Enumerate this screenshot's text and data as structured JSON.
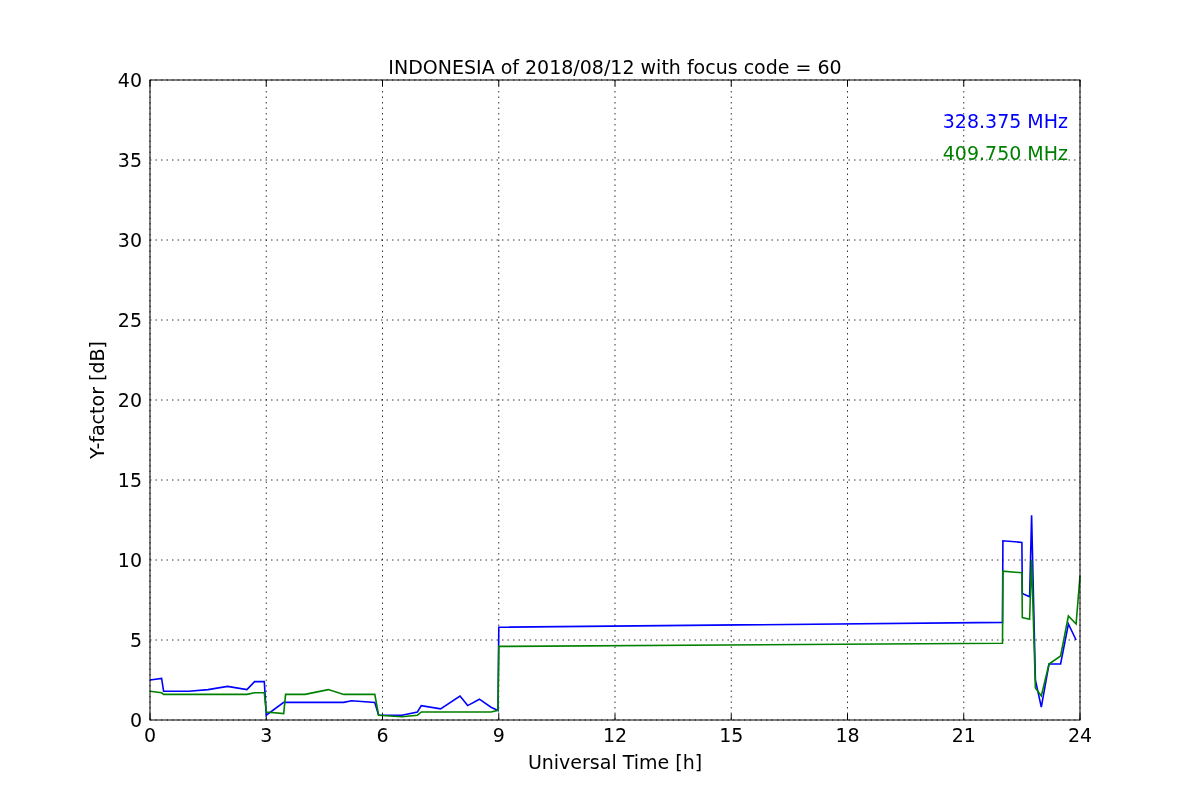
{
  "chart_data": {
    "type": "line",
    "title": "INDONESIA of 2018/08/12 with focus code = 60",
    "xlabel": "Universal Time [h]",
    "ylabel": "Y-factor [dB]",
    "x": [
      0,
      0.3,
      0.35,
      1,
      1.5,
      2,
      2.5,
      2.7,
      2.95,
      3.0,
      3.45,
      3.5,
      4,
      4.6,
      5,
      5.2,
      5.8,
      5.9,
      6.5,
      6.9,
      7,
      7.5,
      8,
      8.2,
      8.5,
      8.8,
      8.98,
      9,
      22,
      22.01,
      22.5,
      22.51,
      22.7,
      22.75,
      22.85,
      23,
      23.2,
      23.5,
      23.7,
      23.9,
      24
    ],
    "series": [
      {
        "name": "328.375 MHz",
        "color": "#0000ff",
        "values": [
          2.5,
          2.6,
          1.8,
          1.8,
          1.9,
          2.1,
          1.9,
          2.4,
          2.4,
          0.3,
          1.1,
          1.1,
          1.1,
          1.1,
          1.1,
          1.2,
          1.1,
          0.3,
          0.3,
          0.5,
          0.9,
          0.7,
          1.5,
          0.9,
          1.3,
          0.8,
          0.6,
          5.8,
          6.1,
          11.2,
          11.1,
          7.9,
          7.7,
          12.8,
          2.5,
          0.8,
          3.5,
          3.5,
          6,
          5,
          null
        ]
      },
      {
        "name": "409.750 MHz",
        "color": "#008000",
        "values": [
          1.8,
          1.7,
          1.6,
          1.6,
          1.6,
          1.6,
          1.6,
          1.7,
          1.7,
          0.5,
          0.4,
          1.6,
          1.6,
          1.9,
          1.6,
          1.6,
          1.6,
          0.3,
          0.2,
          0.3,
          0.5,
          0.5,
          0.5,
          0.5,
          0.5,
          0.5,
          0.6,
          4.6,
          4.8,
          9.3,
          9.2,
          6.4,
          6.3,
          10,
          2,
          1.5,
          3.5,
          4,
          6.5,
          6,
          9
        ]
      }
    ],
    "xlim": [
      0,
      24
    ],
    "ylim": [
      0,
      40
    ],
    "xticks": [
      0,
      3,
      6,
      9,
      12,
      15,
      18,
      21,
      24
    ],
    "yticks": [
      0,
      5,
      10,
      15,
      20,
      25,
      30,
      35,
      40
    ],
    "grid": true
  }
}
